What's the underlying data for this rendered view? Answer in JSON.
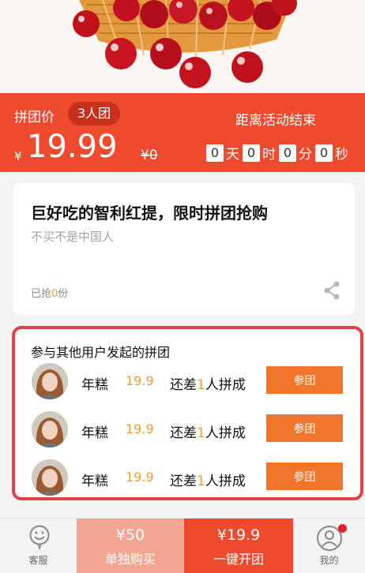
{
  "price_bar": {
    "label": "拼团价",
    "badge": "3人团",
    "currency": "¥",
    "price": "19.99",
    "original": "¥0",
    "countdown_label": "距离活动结束",
    "countdown": {
      "days": "0",
      "days_unit": "天",
      "hours": "0",
      "hours_unit": "时",
      "minutes": "0",
      "minutes_unit": "分",
      "seconds": "0",
      "seconds_unit": "秒"
    }
  },
  "product": {
    "title": "巨好吃的智利红提，限时拼团抢购",
    "subtitle": "不买不是中国人",
    "sold_prefix": "已抢",
    "sold_count": "0",
    "sold_suffix": "份"
  },
  "group_buy": {
    "title": "参与其他用户发起的拼团",
    "rows": [
      {
        "name": "年糕",
        "price": "19.9",
        "need_prefix": "还差",
        "need_count": "1",
        "need_suffix": "人拼成",
        "button": "参团"
      },
      {
        "name": "年糕",
        "price": "19.9",
        "need_prefix": "还差",
        "need_count": "1",
        "need_suffix": "人拼成",
        "button": "参团"
      },
      {
        "name": "年糕",
        "price": "19.9",
        "need_prefix": "还差",
        "need_count": "1",
        "need_suffix": "人拼成",
        "button": "参团"
      }
    ]
  },
  "bottom_bar": {
    "service_label": "客服",
    "solo_price": "¥50",
    "solo_action": "单独购买",
    "group_price": "¥19.9",
    "group_action": "一键开团",
    "me_label": "我的"
  },
  "colors": {
    "accent": "#ee4b2e",
    "highlight": "#f29b39",
    "button": "#f1752a",
    "frame": "#e3404a"
  },
  "icons": [
    "smile-service-icon",
    "share-icon",
    "user-profile-icon",
    "notification-dot"
  ]
}
